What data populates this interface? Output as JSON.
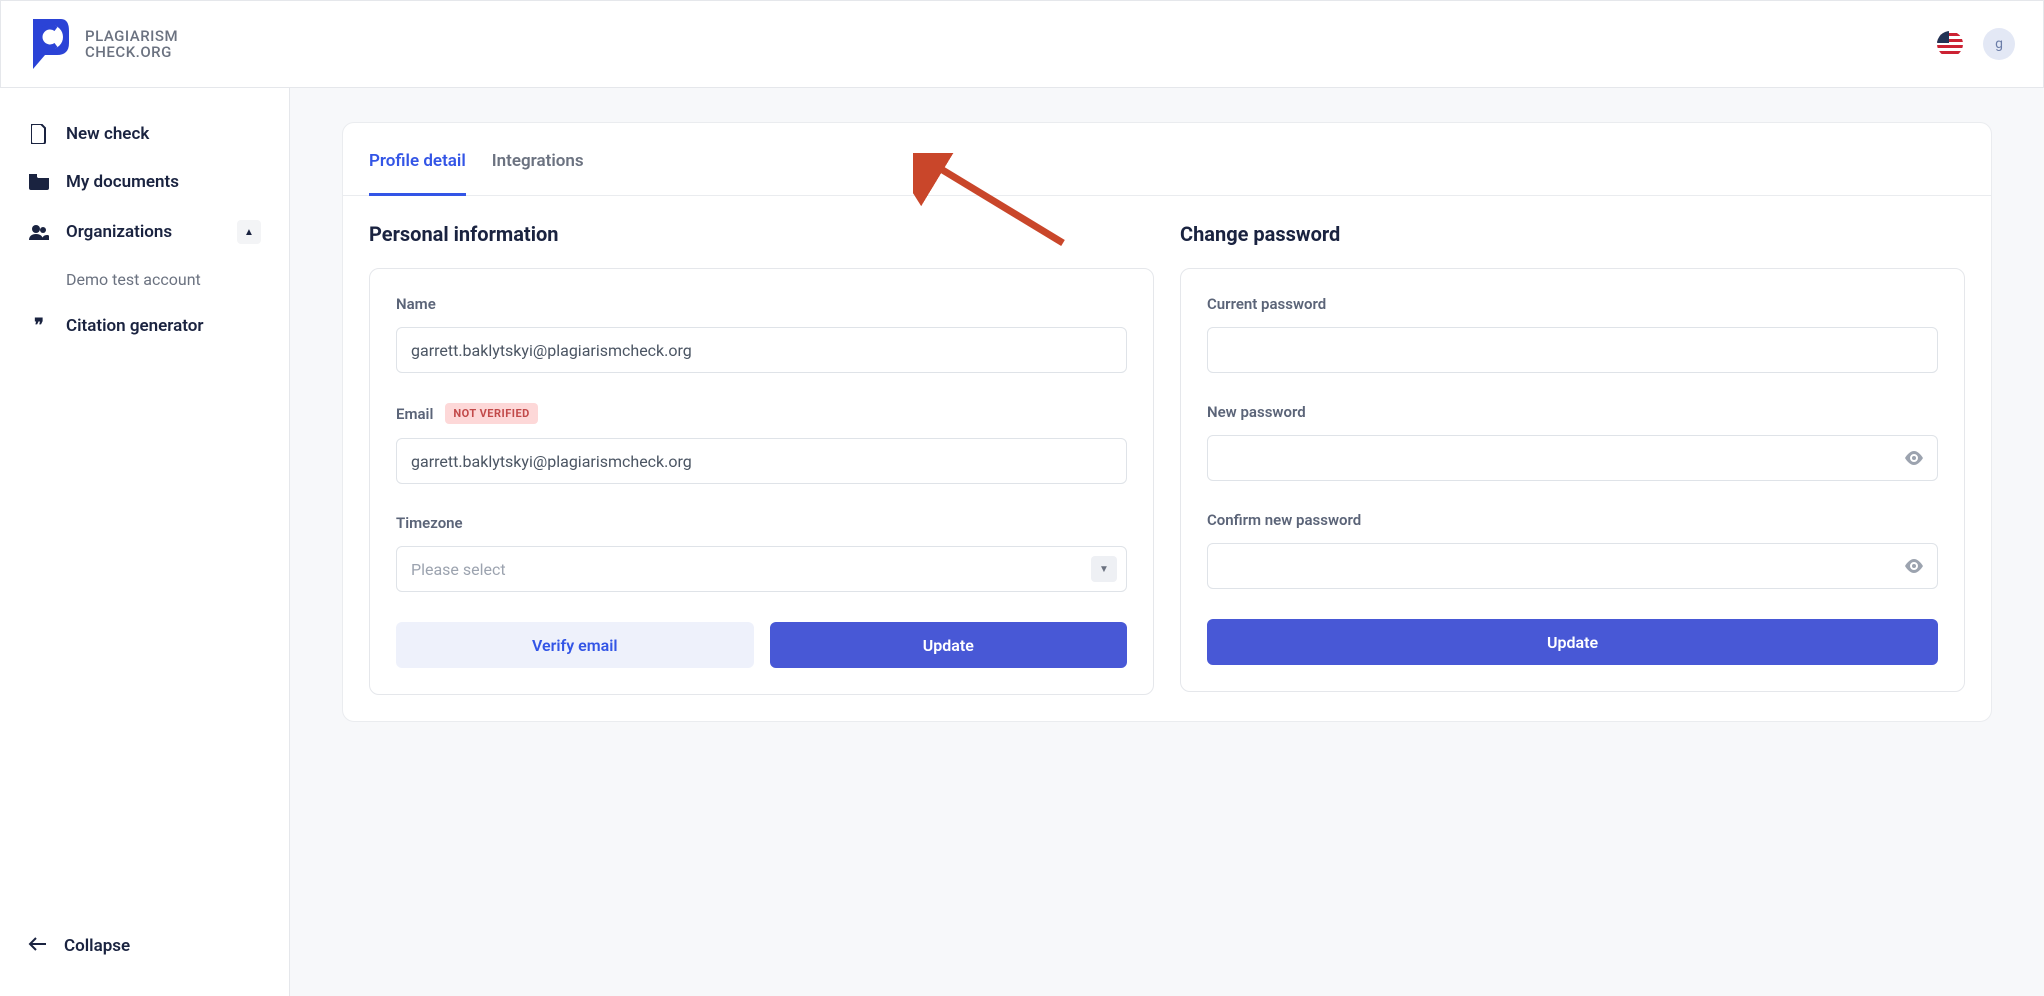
{
  "brand": {
    "line1": "PLAGIARISM",
    "line2": "CHECK.ORG"
  },
  "header": {
    "avatar_initial": "g"
  },
  "sidebar": {
    "items": [
      {
        "label": "New check"
      },
      {
        "label": "My documents"
      },
      {
        "label": "Organizations"
      },
      {
        "label": "Citation generator"
      }
    ],
    "sub_org": "Demo test account",
    "collapse": "Collapse"
  },
  "tabs": {
    "profile": "Profile detail",
    "integrations": "Integrations"
  },
  "personal": {
    "title": "Personal information",
    "name_label": "Name",
    "name_value": "garrett.baklytskyi@plagiarismcheck.org",
    "email_label": "Email",
    "email_badge": "NOT VERIFIED",
    "email_value": "garrett.baklytskyi@plagiarismcheck.org",
    "timezone_label": "Timezone",
    "timezone_placeholder": "Please select",
    "verify_button": "Verify email",
    "update_button": "Update"
  },
  "password": {
    "title": "Change password",
    "current_label": "Current password",
    "new_label": "New password",
    "confirm_label": "Confirm new password",
    "update_button": "Update"
  }
}
